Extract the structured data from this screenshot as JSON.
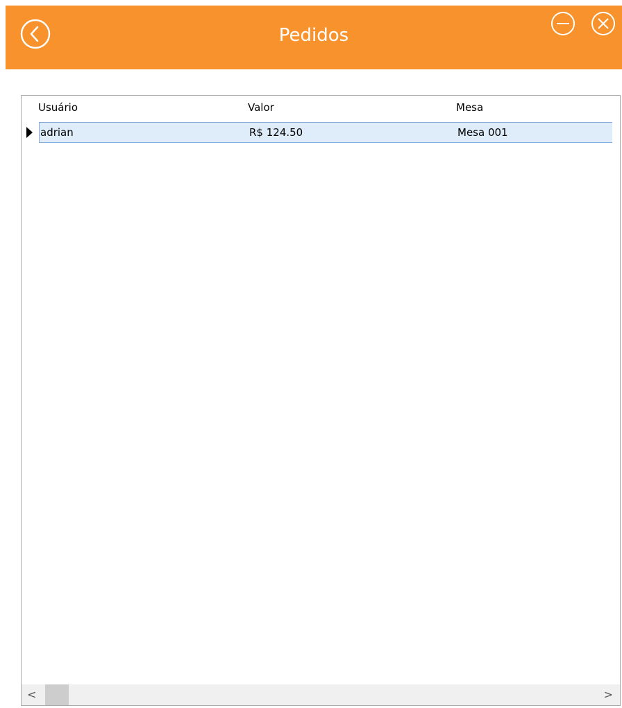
{
  "header": {
    "title": "Pedidos",
    "back_icon": "chevron-left-circle-icon",
    "minimize_icon": "minus-circle-icon",
    "close_icon": "close-circle-icon",
    "background_color": "#f7922c"
  },
  "grid": {
    "columns": [
      "Usuário",
      "Valor",
      "Mesa"
    ],
    "rows": [
      {
        "usuario": "adrian",
        "valor": "R$ 124.50",
        "mesa": "Mesa 001",
        "selected": true
      }
    ],
    "selection_color": "#dfedfb"
  },
  "scrollbar": {
    "left_glyph": "<",
    "right_glyph": ">"
  }
}
